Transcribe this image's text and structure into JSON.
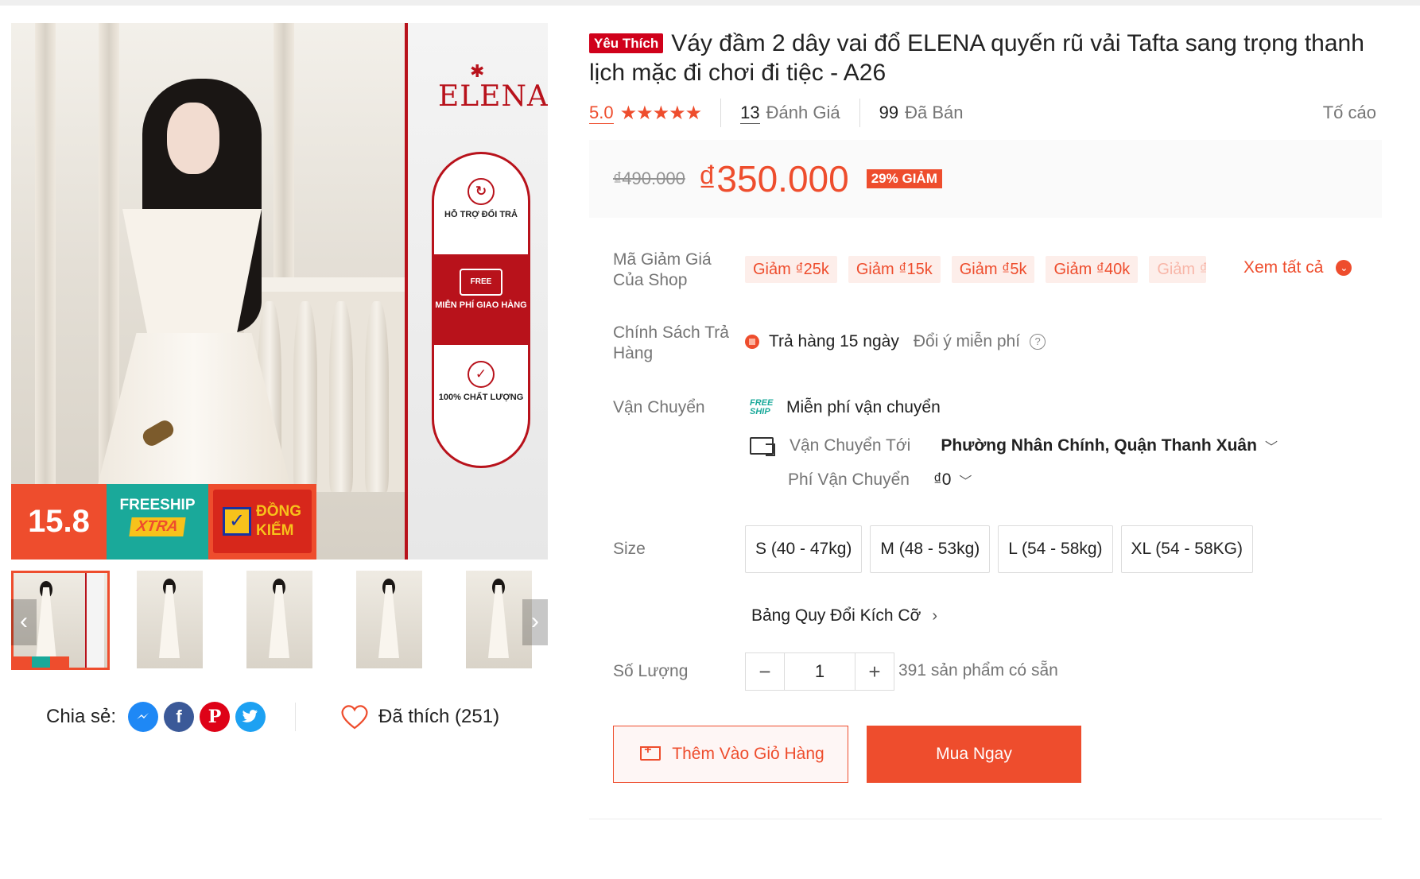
{
  "gallery": {
    "brand_name": "ELENA",
    "badges": [
      {
        "icon": "box-return-icon",
        "label": "HỖ TRỢ ĐỔI TRẢ"
      },
      {
        "icon": "free-truck-icon",
        "label": "MIỄN PHÍ GIAO HÀNG",
        "tag": "FREE"
      },
      {
        "icon": "quality-badge-icon",
        "label": "100% CHẤT LƯỢNG"
      }
    ],
    "promo": {
      "date": "15.8",
      "freeship": "FREESHIP",
      "xtra": "XTRA",
      "check_line1": "ĐỒNG",
      "check_line2": "KIỂM"
    },
    "thumbnail_count": 5
  },
  "share": {
    "label": "Chia sẻ:",
    "networks": [
      "messenger-icon",
      "facebook-icon",
      "pinterest-icon",
      "twitter-icon"
    ]
  },
  "like": {
    "label": "Đã thích (251)"
  },
  "product": {
    "badge": "Yêu Thích",
    "title": "Váy đầm 2 dây vai đổ ELENA quyến rũ vải Tafta sang trọng thanh lịch mặc đi chơi đi tiệc - A26",
    "rating": "5.0",
    "stars": "★★★★★",
    "review_count": "13",
    "review_label": "Đánh Giá",
    "sold_count": "99",
    "sold_label": "Đã Bán",
    "report": "Tố cáo"
  },
  "price": {
    "original": "₫490.000",
    "current": "₫350.000",
    "discount": "29% GIẢM"
  },
  "vouchers": {
    "label": "Mã Giảm Giá Của Shop",
    "items": [
      "Giảm ₫25k",
      "Giảm ₫15k",
      "Giảm ₫5k",
      "Giảm ₫40k",
      "Giảm ₫"
    ],
    "see_all": "Xem tất cả"
  },
  "returns": {
    "label": "Chính Sách Trả Hàng",
    "policy": "Trả hàng 15 ngày",
    "note": "Đổi ý miễn phí"
  },
  "shipping": {
    "label": "Vận Chuyển",
    "free_logo_line1": "FREE",
    "free_logo_line2": "SHIP",
    "free_text": "Miễn phí vận chuyển",
    "to_label": "Vận Chuyển Tới",
    "to_value": "Phường Nhân Chính, Quận Thanh Xuân",
    "fee_label": "Phí Vận Chuyển",
    "fee_value": "₫0"
  },
  "size": {
    "label": "Size",
    "options": [
      "S (40 - 47kg)",
      "M (48 - 53kg)",
      "L (54 - 58kg)",
      "XL (54 - 58KG)"
    ],
    "chart_link": "Bảng Quy Đổi Kích Cỡ"
  },
  "quantity": {
    "label": "Số Lượng",
    "value": "1",
    "minus": "−",
    "plus": "+",
    "stock": "391 sản phẩm có sẵn"
  },
  "actions": {
    "add_to_cart": "Thêm Vào Giỏ Hàng",
    "buy_now": "Mua Ngay"
  },
  "colors": {
    "accent": "#ee4d2d",
    "brand_red": "#b8121b",
    "teal": "#1aa99a"
  }
}
